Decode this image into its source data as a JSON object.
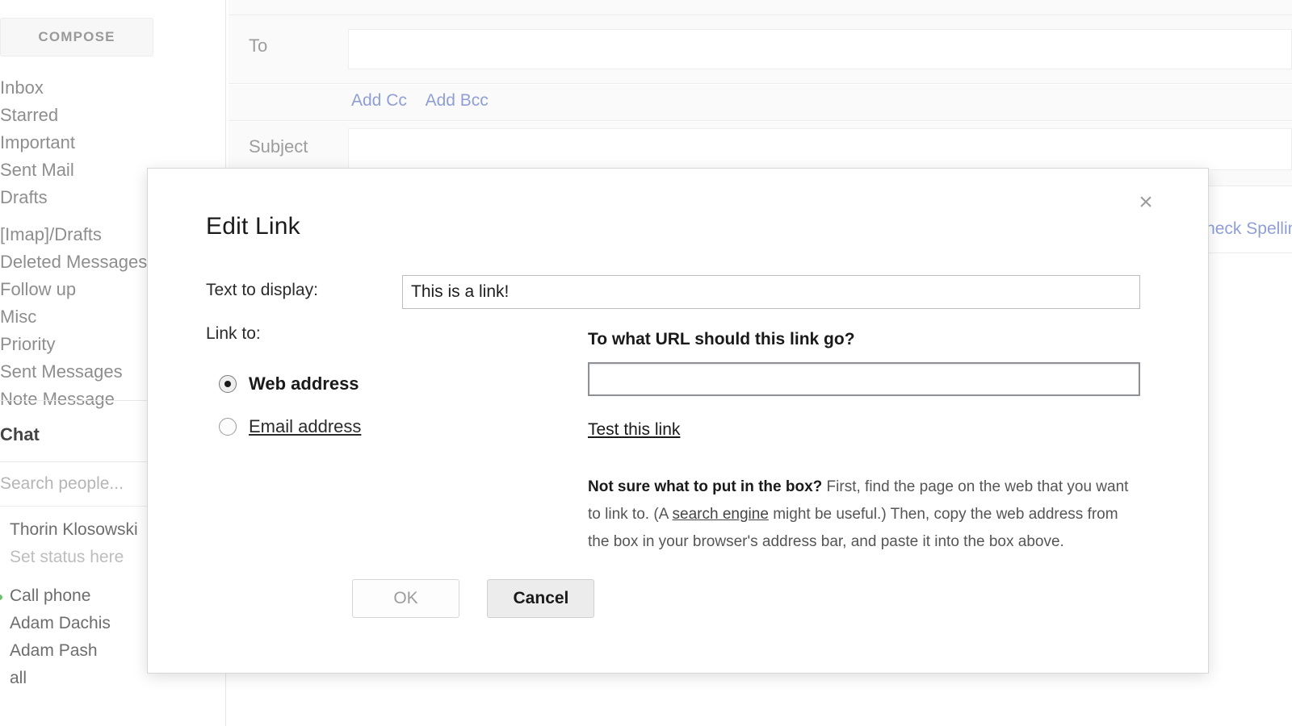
{
  "sidebar": {
    "compose_label": "COMPOSE",
    "nav_items": [
      "Inbox",
      "Starred",
      "Important",
      "Sent Mail",
      "Drafts"
    ],
    "folder_items": [
      "[Imap]/Drafts",
      "Deleted Messages",
      "Follow up",
      "Misc",
      "Priority",
      "Sent Messages",
      "Note Message"
    ],
    "chat_header": "Chat",
    "chat_search_placeholder": "Search people...",
    "chat_user": "Thorin Klosowski",
    "chat_status": "Set status here",
    "chat_contacts": [
      "Call phone",
      "Adam Dachis",
      "Adam Pash",
      "all"
    ]
  },
  "compose": {
    "to_label": "To",
    "to_value": "",
    "add_cc_label": "Add Cc",
    "add_bcc_label": "Add Bcc",
    "subject_label": "Subject",
    "subject_value": "",
    "check_spelling_label": "Check Spelling"
  },
  "dialog": {
    "title": "Edit Link",
    "close_glyph": "×",
    "text_to_display_label": "Text to display:",
    "text_to_display_value": "This is a link!",
    "link_to_label": "Link to:",
    "radio_options": [
      {
        "label": "Web address",
        "selected": true
      },
      {
        "label": "Email address",
        "selected": false
      }
    ],
    "url_question": "To what URL should this link go?",
    "url_value": "",
    "test_link_label": "Test this link",
    "help_bold": "Not sure what to put in the box?",
    "help_part1": " First, find the page on the web that you want to link to. (A ",
    "help_link": "search engine",
    "help_part2": " might be useful.) Then, copy the web address from the box in your browser's address bar, and paste it into the box above.",
    "ok_label": "OK",
    "cancel_label": "Cancel"
  },
  "colors": {
    "link_blue": "#8f9fd6",
    "text_dark": "#1a1a1a",
    "text_muted": "#8e8e8e",
    "presence_green": "#6ec06e"
  }
}
